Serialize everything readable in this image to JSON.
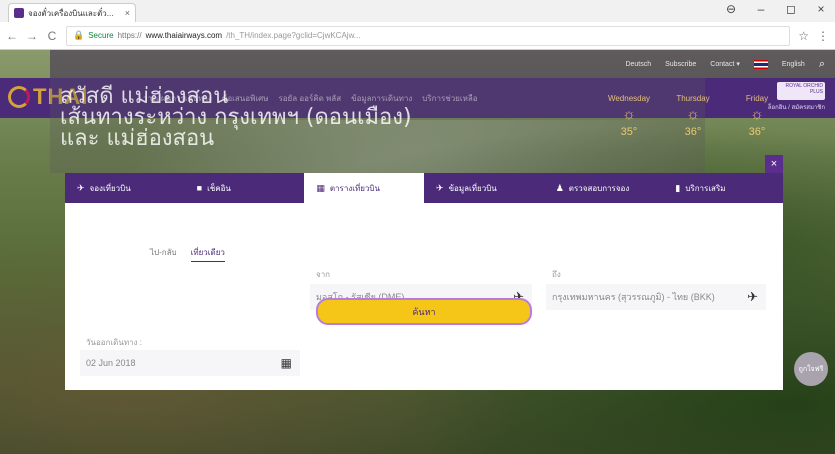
{
  "browser": {
    "tab_title": "จองตั๋วเครื่องบินและตั๋ว...",
    "tab_close": "×",
    "window_controls": [
      "⊖",
      "–",
      "◻",
      "×"
    ],
    "nav": {
      "back": "←",
      "forward": "→",
      "reload": "C"
    },
    "url_secure": "Secure",
    "url_scheme": "https://",
    "url_host": "www.thaiairways.com",
    "url_rest": "/th_TH/index.page?gclid=CjwKCAjw...",
    "bookmark": "☆",
    "menu": "⋮"
  },
  "topstrip": {
    "items": [
      "Deutsch",
      "Subscribe",
      "Contact ▾",
      "English"
    ]
  },
  "brand": {
    "logo_text": "THAI",
    "menu": [
      "วางแผนการเดินทาง",
      "ข้อเสนอพิเศษ",
      "รอยัล ออร์คิด พลัส",
      "ข้อมูลการเดินทาง",
      "บริการช่วยเหลือ"
    ],
    "rop_badge": "ROYAL ORCHID PLUS",
    "rop_links": "ล็อกอิน / สมัครสมาชิก"
  },
  "hero": {
    "line1": "สวัสดี แม่ฮ่องสอน",
    "line2": "เส้นทางระหว่าง กรุงเทพฯ (ดอนเมือง)",
    "line3": "และ แม่ฮ่องสอน",
    "weather": [
      {
        "day": "Wednesday",
        "temp": "35°"
      },
      {
        "day": "Thursday",
        "temp": "36°"
      },
      {
        "day": "Friday",
        "temp": "36°"
      }
    ]
  },
  "booking": {
    "close": "×",
    "tabs": [
      {
        "icon": "✈",
        "label": "จองเที่ยวบิน"
      },
      {
        "icon": "■",
        "label": "เช็คอิน"
      },
      {
        "icon": "▦",
        "label": "ตารางเที่ยวบิน"
      },
      {
        "icon": "✈",
        "label": "ข้อมูลเที่ยวบิน"
      },
      {
        "icon": "♟",
        "label": "ตรวจสอบการจอง"
      },
      {
        "icon": "▮",
        "label": "บริการเสริม"
      }
    ],
    "trip_types": [
      "ไป-กลับ",
      "เที่ยวเดียว"
    ],
    "from_label": "จาก",
    "from_value": "มอสโก - รัสเซีย (DME)",
    "to_label": "ถึง",
    "to_value": "กรุงเทพมหานคร (สุวรรณภูมิ) - ไทย (BKK)",
    "date_label": "วันออกเดินทาง :",
    "date_value": "02 Jun 2018",
    "search_label": "ค้นหา"
  },
  "chat": {
    "label": "ถูกใจฟรี"
  },
  "colors": {
    "brand_purple": "#4b2a7a",
    "gold": "#d4a43a",
    "search_yellow": "#f5c518"
  }
}
